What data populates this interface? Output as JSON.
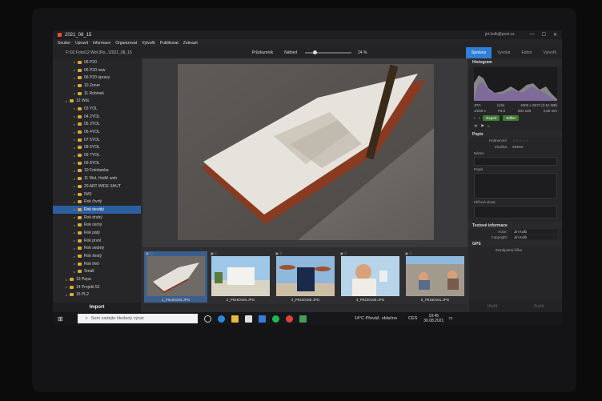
{
  "window": {
    "title": "2021_08_15",
    "user": "jiri.kolb@post.cz"
  },
  "menu": [
    "Soubor",
    "Upravit",
    "Informace",
    "Organizovat",
    "Vytvořit",
    "Publikovat",
    "Zobrazit"
  ],
  "toolbar": {
    "path": "F:\\02 Foto\\12 Wot (Ro...\\2021_08_15",
    "browse_label": "Průzkumník",
    "preview_label": "Náhled",
    "zoom": "24 %"
  },
  "right_tabs": [
    "Správce",
    "Vyvolat",
    "Editor",
    "Vytvořit"
  ],
  "folders": [
    {
      "label": "06 P20",
      "indent": 3,
      "selected": false
    },
    {
      "label": "06 P20 new",
      "indent": 3,
      "selected": false
    },
    {
      "label": "06 P20 úpravy",
      "indent": 3,
      "selected": false
    },
    {
      "label": "10 Zoner",
      "indent": 3,
      "selected": false
    },
    {
      "label": "11 Robinek",
      "indent": 3,
      "selected": false
    },
    {
      "label": "12 WoL",
      "indent": 2,
      "selected": false
    },
    {
      "label": "03 YOL",
      "indent": 3,
      "selected": false
    },
    {
      "label": "04 2YOL",
      "indent": 3,
      "selected": false
    },
    {
      "label": "05 3YOL",
      "indent": 3,
      "selected": false
    },
    {
      "label": "06 4YOL",
      "indent": 3,
      "selected": false
    },
    {
      "label": "07 5YOL",
      "indent": 3,
      "selected": false
    },
    {
      "label": "08 6YOL",
      "indent": 3,
      "selected": false
    },
    {
      "label": "09 7YOL",
      "indent": 3,
      "selected": false
    },
    {
      "label": "09 8YOL",
      "indent": 3,
      "selected": false
    },
    {
      "label": "10 Fotobanka",
      "indent": 3,
      "selected": false
    },
    {
      "label": "11 WoL Hotlič web",
      "indent": 3,
      "selected": false
    },
    {
      "label": "20 ART WIDE SHUT",
      "indent": 3,
      "selected": false
    },
    {
      "label": "IWS",
      "indent": 3,
      "selected": false
    },
    {
      "label": "Rok čtvrtý",
      "indent": 3,
      "selected": false
    },
    {
      "label": "Rok devátý",
      "indent": 3,
      "selected": true
    },
    {
      "label": "Rok druhý",
      "indent": 3,
      "selected": false
    },
    {
      "label": "Rok osmý",
      "indent": 3,
      "selected": false
    },
    {
      "label": "Rok pátý",
      "indent": 3,
      "selected": false
    },
    {
      "label": "Rok první",
      "indent": 3,
      "selected": false
    },
    {
      "label": "Rok sedmý",
      "indent": 3,
      "selected": false
    },
    {
      "label": "Rok šestý",
      "indent": 3,
      "selected": false
    },
    {
      "label": "Rok třetí",
      "indent": 3,
      "selected": false
    },
    {
      "label": "Small",
      "indent": 3,
      "selected": false
    },
    {
      "label": "13 Pepa",
      "indent": 2,
      "selected": false
    },
    {
      "label": "14 Projekt 52",
      "indent": 2,
      "selected": false
    },
    {
      "label": "15 PL2",
      "indent": 2,
      "selected": false
    }
  ],
  "import_label": "Import",
  "thumbnails": [
    {
      "caption": "1_P8150183.JPG",
      "selected": true,
      "scene": "lounger"
    },
    {
      "caption": "2_P8150184.JPG",
      "selected": false,
      "scene": "hut"
    },
    {
      "caption": "3_P8150185.JPG",
      "selected": false,
      "scene": "book"
    },
    {
      "caption": "4_P8150190.JPG",
      "selected": false,
      "scene": "person"
    },
    {
      "caption": "5_P8150191.JPG",
      "selected": false,
      "scene": "sand"
    }
  ],
  "info": {
    "histogram_title": "Histogram",
    "format": "JPG",
    "counter": "(1/9)",
    "dimensions": "4000 x 2672 (2.51 MB)",
    "shutter": "1/250 s",
    "aperture": "F8,0",
    "iso": "ISO 100",
    "focal": "4,50 mm",
    "export_label": "Export",
    "share_label": "Sdílet",
    "section_popis": "Popis",
    "rating_label": "Hodnocení:",
    "labels_label": "Značka:",
    "name_label": "Název",
    "desc_label": "Popis",
    "keywords_label": "Klíčová slova",
    "section_tech": "Textové informace",
    "author_label": "Autor:",
    "author_value": "Jiri Kolb",
    "copyright_label": "Copyright:",
    "copyright_value": "Jiri Kolb",
    "section_gps": "GPS",
    "gps_label": "Zeměpisná šířka",
    "btn_undo": "Uložit",
    "btn_revert": "Zrušit"
  },
  "taskbar": {
    "search_placeholder": "Sem zadejte hledaný výraz",
    "weather": "14°C  Převáž. oblačno",
    "lang": "CES",
    "time": "19:45",
    "date": "30.08.2021"
  },
  "colors": {
    "accent": "#2f7fd6",
    "folder": "#d9a93a",
    "selected_row": "#2c5fa0",
    "export_green": "#3f7a35"
  }
}
